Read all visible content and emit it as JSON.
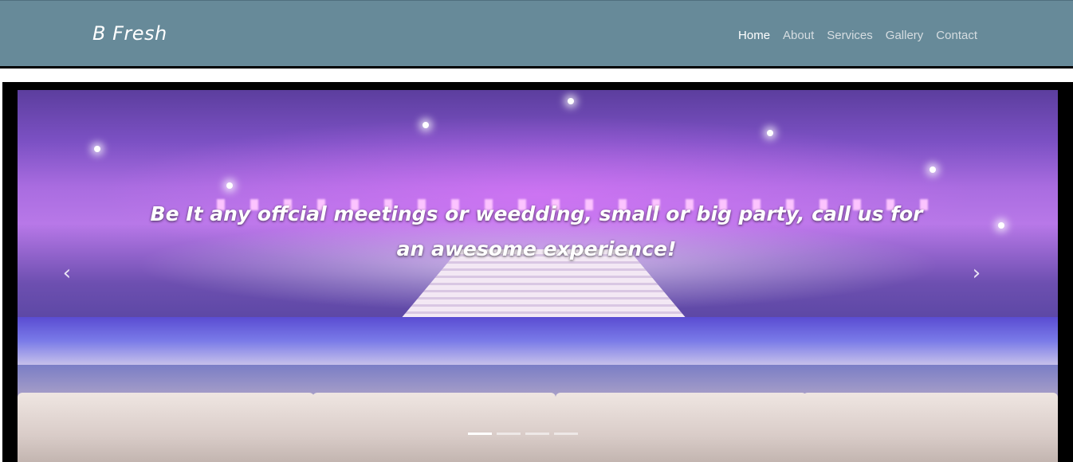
{
  "navbar": {
    "brand": "B Fresh",
    "items": [
      {
        "label": "Home",
        "active": true
      },
      {
        "label": "About",
        "active": false
      },
      {
        "label": "Services",
        "active": false
      },
      {
        "label": "Gallery",
        "active": false
      },
      {
        "label": "Contact",
        "active": false
      }
    ],
    "colors": {
      "background": "#678a99",
      "active_text": "#ffffff",
      "text": "#d6dde1"
    }
  },
  "carousel": {
    "caption": "Be It any offcial meetings or weedding, small or big party, call us for an awesome experience!",
    "prev_icon": "chevron-left-icon",
    "next_icon": "chevron-right-icon",
    "indicators": [
      {
        "active": true
      },
      {
        "active": false
      },
      {
        "active": false
      },
      {
        "active": false
      }
    ]
  }
}
